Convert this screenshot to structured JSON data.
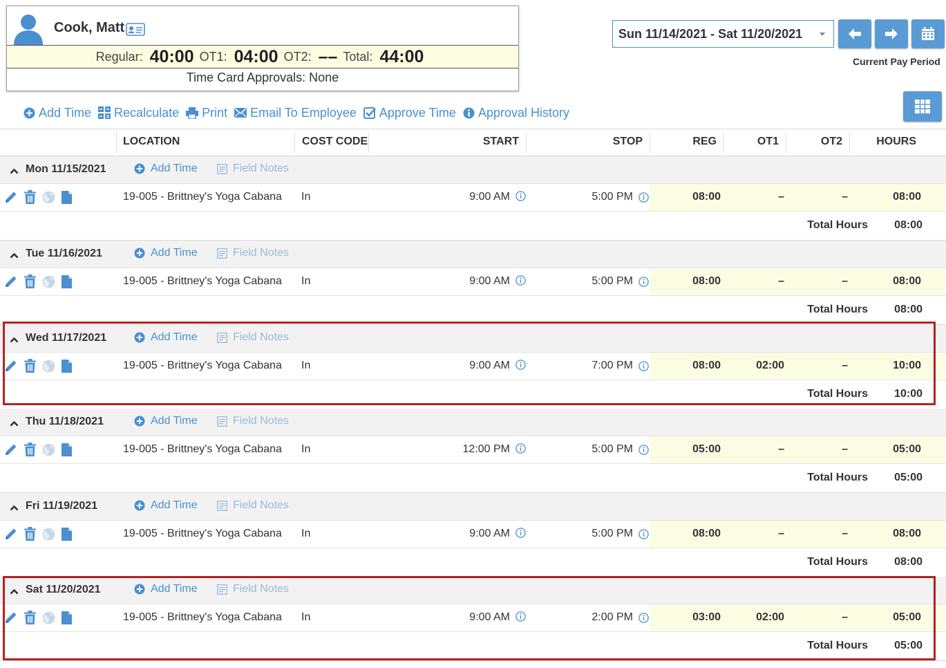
{
  "employee": {
    "name": "Cook, Matt",
    "regular_label": "Regular:",
    "regular_value": "40:00",
    "ot1_label": "OT1:",
    "ot1_value": "04:00",
    "ot2_label": "OT2:",
    "ot2_value": "––",
    "total_label": "Total:",
    "total_value": "44:00",
    "approvals": "Time Card Approvals: None"
  },
  "period": {
    "selected": "Sun 11/14/2021 - Sat 11/20/2021",
    "current_pay_period": "Current Pay Period"
  },
  "toolbar": {
    "add_time": "Add Time",
    "recalculate": "Recalculate",
    "print": "Print",
    "email": "Email To Employee",
    "approve": "Approve Time",
    "history": "Approval History"
  },
  "columns": {
    "location": "LOCATION",
    "cost_code": "COST CODE",
    "start": "START",
    "stop": "STOP",
    "reg": "REG",
    "ot1": "OT1",
    "ot2": "OT2",
    "hours": "HOURS"
  },
  "labels": {
    "add_time": "Add Time",
    "field_notes": "Field Notes",
    "total_hours": "Total Hours"
  },
  "days": [
    {
      "date": "Mon 11/15/2021",
      "location": "19-005 - Brittney's Yoga Cabana",
      "cost_code": "In",
      "start": "9:00 AM",
      "stop": "5:00 PM",
      "reg": "08:00",
      "ot1": "–",
      "ot2": "–",
      "hours": "08:00",
      "total": "08:00"
    },
    {
      "date": "Tue 11/16/2021",
      "location": "19-005 - Brittney's Yoga Cabana",
      "cost_code": "In",
      "start": "9:00 AM",
      "stop": "5:00 PM",
      "reg": "08:00",
      "ot1": "–",
      "ot2": "–",
      "hours": "08:00",
      "total": "08:00"
    },
    {
      "date": "Wed 11/17/2021",
      "location": "19-005 - Brittney's Yoga Cabana",
      "cost_code": "In",
      "start": "9:00 AM",
      "stop": "7:00 PM",
      "reg": "08:00",
      "ot1": "02:00",
      "ot2": "–",
      "hours": "10:00",
      "total": "10:00"
    },
    {
      "date": "Thu 11/18/2021",
      "location": "19-005 - Brittney's Yoga Cabana",
      "cost_code": "In",
      "start": "12:00 PM",
      "stop": "5:00 PM",
      "reg": "05:00",
      "ot1": "–",
      "ot2": "–",
      "hours": "05:00",
      "total": "05:00"
    },
    {
      "date": "Fri 11/19/2021",
      "location": "19-005 - Brittney's Yoga Cabana",
      "cost_code": "In",
      "start": "9:00 AM",
      "stop": "5:00 PM",
      "reg": "08:00",
      "ot1": "–",
      "ot2": "–",
      "hours": "08:00",
      "total": "08:00"
    },
    {
      "date": "Sat 11/20/2021",
      "location": "19-005 - Brittney's Yoga Cabana",
      "cost_code": "In",
      "start": "9:00 AM",
      "stop": "2:00 PM",
      "reg": "03:00",
      "ot1": "02:00",
      "ot2": "–",
      "hours": "05:00",
      "total": "05:00"
    }
  ],
  "highlighted_days": [
    "Wed 11/17/2021",
    "Sat 11/20/2021"
  ],
  "colors": {
    "accent": "#4a8fd0",
    "button": "#5b9bd5",
    "hours_bg": "#fcfde0",
    "highlight": "#b22222"
  }
}
